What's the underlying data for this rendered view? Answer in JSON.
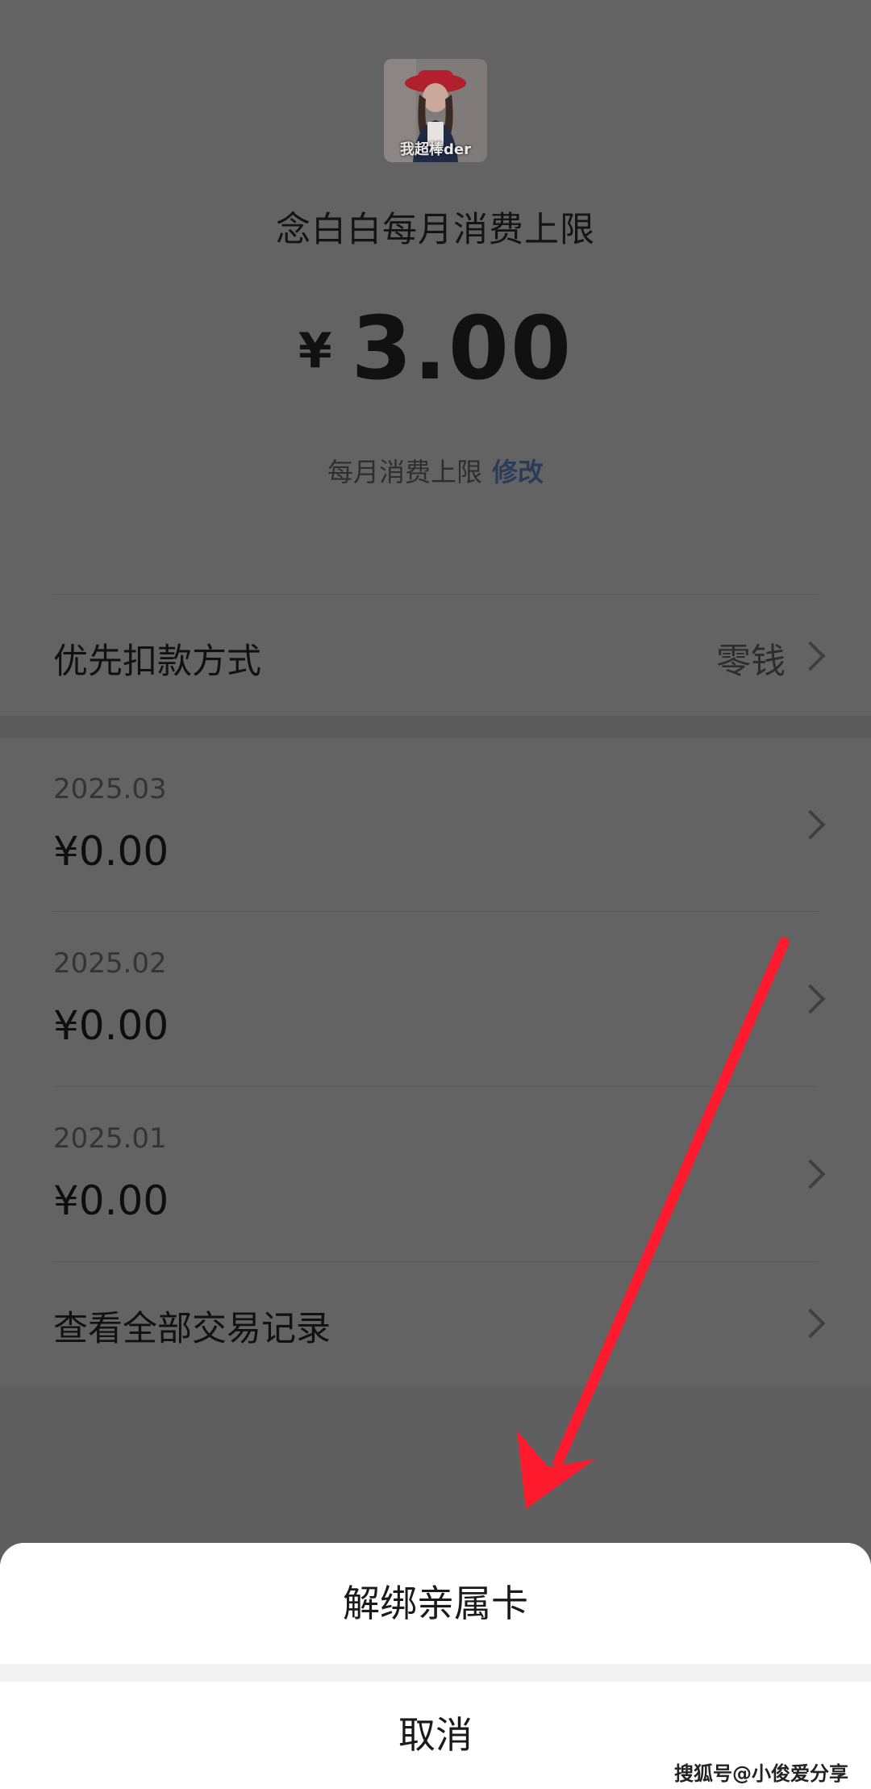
{
  "header": {
    "avatar_caption": "我超棒der",
    "title": "念白白每月消费上限",
    "amount_currency": "¥",
    "amount_value": "3.00",
    "limit_label": "每月消费上限",
    "limit_edit": "修改"
  },
  "payment": {
    "label": "优先扣款方式",
    "value": "零钱"
  },
  "months": [
    {
      "date": "2025.03",
      "amount": "¥0.00"
    },
    {
      "date": "2025.02",
      "amount": "¥0.00"
    },
    {
      "date": "2025.01",
      "amount": "¥0.00"
    }
  ],
  "all_records_label": "查看全部交易记录",
  "sheet": {
    "unbind_label": "解绑亲属卡",
    "cancel_label": "取消"
  },
  "watermark": "搜狐号@小俊爱分享",
  "colors": {
    "overlay": "#636363",
    "link": "#2a3c5a",
    "annotation_arrow": "#ff1a2e"
  }
}
